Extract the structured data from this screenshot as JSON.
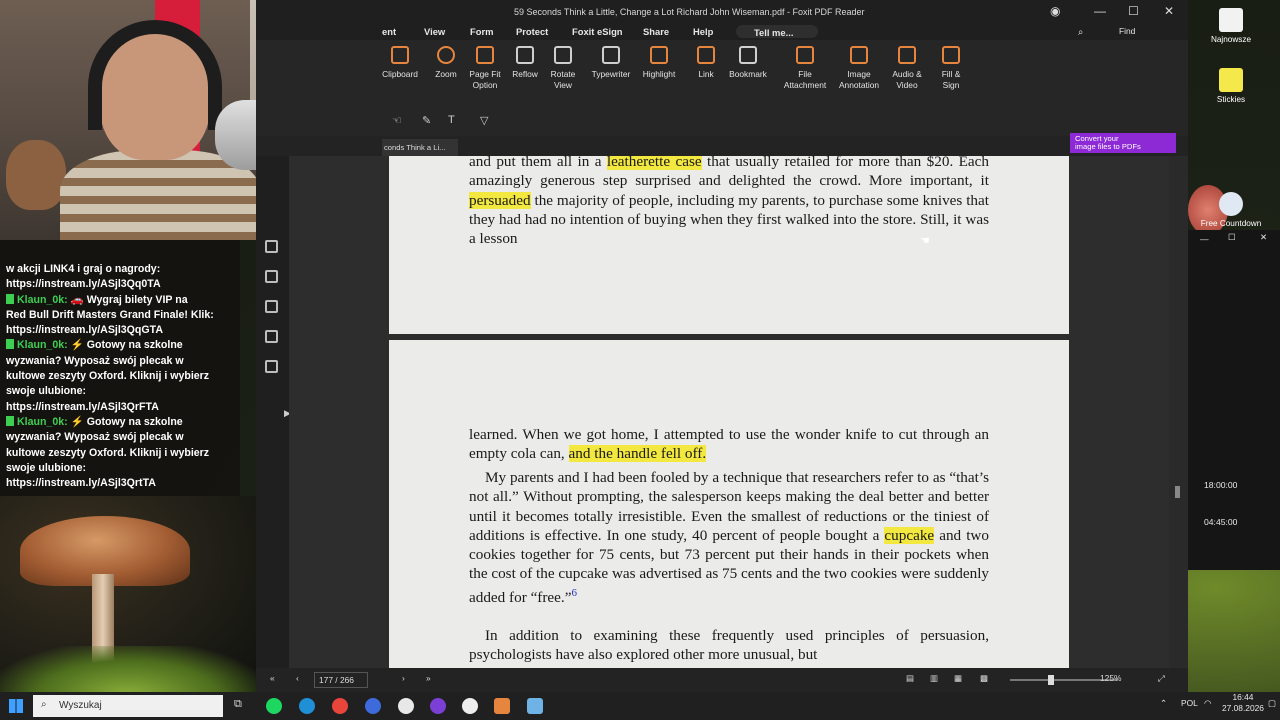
{
  "foxit": {
    "title": "59 Seconds Think a Little, Change a Lot Richard John Wiseman.pdf - Foxit PDF Reader",
    "menu": [
      "ent",
      "View",
      "Form",
      "Protect",
      "Foxit eSign",
      "Share",
      "Help"
    ],
    "tell_me": "Tell me...",
    "find": "Find",
    "ribbon": [
      {
        "label": "Clipboard",
        "icon": "clipboard-icon"
      },
      {
        "label": "Zoom",
        "icon": "zoom-icon"
      },
      {
        "label": "Page Fit Option",
        "icon": "page-fit-icon"
      },
      {
        "label": "Reflow",
        "icon": "reflow-icon"
      },
      {
        "label": "Rotate View",
        "icon": "rotate-icon"
      },
      {
        "label": "Typewriter",
        "icon": "typewriter-icon"
      },
      {
        "label": "Highlight",
        "icon": "highlight-icon"
      },
      {
        "label": "Link",
        "icon": "link-icon"
      },
      {
        "label": "Bookmark",
        "icon": "bookmark-icon"
      },
      {
        "label": "File Attachment",
        "icon": "file-attachment-icon"
      },
      {
        "label": "Image Annotation",
        "icon": "image-annotation-icon"
      },
      {
        "label": "Audio & Video",
        "icon": "audio-video-icon"
      },
      {
        "label": "Fill & Sign",
        "icon": "fill-sign-icon"
      }
    ],
    "doc_tab": "conds Think a Li...",
    "convert_banner_line1": "Convert your",
    "convert_banner_line2": "image files to PDFs",
    "page_indicator": "177 / 266",
    "zoom_level": "125%",
    "accent_color": "#e6853d",
    "highlight_color": "#f2e83f"
  },
  "page1": {
    "l1a": "and put them all in a ",
    "l1h": "leatherette case",
    "l1b": " that usually retailed for more than $20. Each amazingly generous step surprised and delighted the crowd. More important, it ",
    "l1h2": "persuaded",
    "l1c": " the majority of people, including my parents, to purchase some knives that they had had no intention of buying when they first walked into the store. Still, it was a lesson"
  },
  "page2": {
    "p1a": "learned. When we got home, I attempted to use the wonder knife to cut through an empty cola can, ",
    "p1h": "and the handle fell off.",
    "p2a": "My parents and I had been fooled by a technique that researchers refer to as “that’s not all.” Without prompting, the salesperson keeps making the deal better and better until it becomes totally irresistible. Even the smallest of reductions or the tiniest of additions is effective. In one study, 40 percent of people bought a ",
    "p2h": "cupcake",
    "p2b": " and two cookies together for 75 cents, but 73 percent put their hands in their pockets when the cost of the cupcake was advertised as 75 cents and the two cookies were suddenly added for “free.”",
    "p2ref": "6",
    "p3": "In addition to examining these frequently used principles of persuasion, psychologists have also explored other more unusual, but"
  },
  "chat": {
    "line0": "w akcji LINK4 i graj o nagrody:",
    "line1": "https://instream.ly/ASjl3Qq0TA",
    "messages": [
      {
        "user": "Klaun_0k:",
        "text": "🚗 Wygraj bilety VIP na",
        "cont": [
          "Red Bull Drift Masters Grand Finale! Klik:",
          "https://instream.ly/ASjl3QqGTA"
        ]
      },
      {
        "user": "Klaun_0k:",
        "text": "⚡ Gotowy na szkolne",
        "cont": [
          "wyzwania? Wyposaż swój plecak w",
          "kultowe zeszyty Oxford. Kliknij i wybierz",
          "swoje ulubione:",
          "https://instream.ly/ASjl3QrFTA"
        ]
      },
      {
        "user": "Klaun_0k:",
        "text": "⚡ Gotowy na szkolne",
        "cont": [
          "wyzwania? Wyposaż swój plecak w",
          "kultowe zeszyty Oxford. Kliknij i wybierz",
          "swoje ulubione:",
          "https://instream.ly/ASjl3QrtTA"
        ]
      }
    ]
  },
  "desktop": {
    "icons": [
      "Najnowsze",
      "Stickies",
      "Free Countdown"
    ],
    "timer1": "18:00:00",
    "timer2": "04:45:00"
  },
  "taskbar": {
    "search_placeholder": "Wyszukaj",
    "lang": "POL",
    "time": "16:44",
    "date": "27.08.2026"
  }
}
